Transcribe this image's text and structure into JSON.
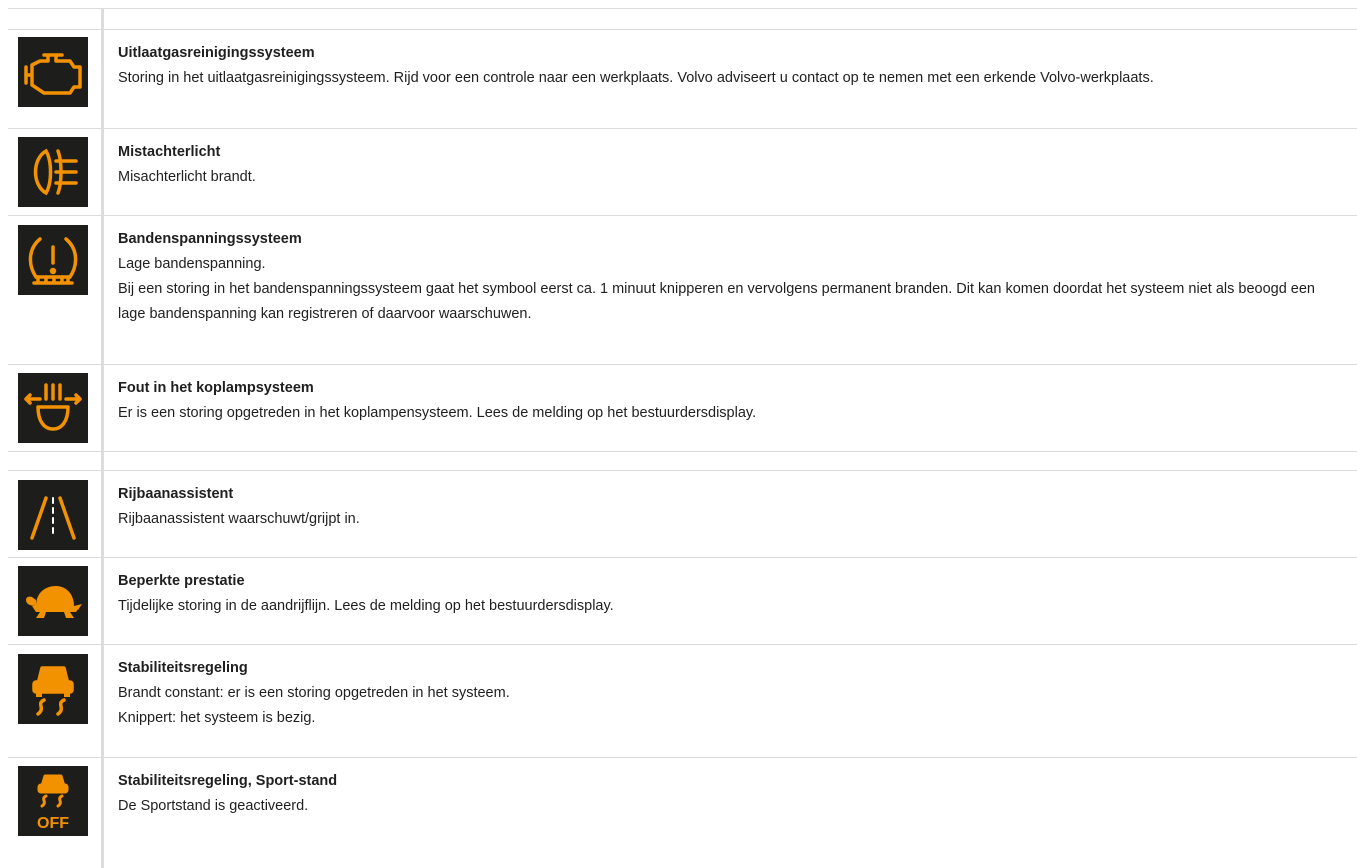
{
  "rows": [
    {
      "icon": "engine-check-icon",
      "title": "Uitlaatgasreinigingssysteem",
      "lines": [
        "Storing in het uitlaatgasreinigingssysteem. Rijd voor een controle naar een werkplaats. Volvo adviseert u contact op te nemen met een erkende Volvo-werkplaats."
      ]
    },
    {
      "icon": "rear-fog-light-icon",
      "title": "Mistachterlicht",
      "lines": [
        "Misachterlicht brandt."
      ]
    },
    {
      "icon": "tire-pressure-icon",
      "title": "Bandenspanningssysteem",
      "lines": [
        "Lage bandenspanning.",
        "Bij een storing in het bandenspanningssysteem gaat het symbool eerst ca. 1 minuut knipperen en vervolgens permanent branden. Dit kan komen doordat het systeem niet als beoogd een lage bandenspanning kan registreren of daarvoor waarschuwen."
      ]
    },
    {
      "icon": "headlamp-fault-icon",
      "title": "Fout in het koplampsysteem",
      "lines": [
        "Er is een storing opgetreden in het koplampensysteem. Lees de melding op het bestuurdersdisplay."
      ]
    },
    {
      "icon": "lane-assist-icon",
      "title": "Rijbaanassistent",
      "lines": [
        "Rijbaanassistent waarschuwt/grijpt in."
      ]
    },
    {
      "icon": "turtle-icon",
      "title": "Beperkte prestatie",
      "lines": [
        "Tijdelijke storing in de aandrijflijn. Lees de melding op het bestuurdersdisplay."
      ]
    },
    {
      "icon": "stability-control-icon",
      "title": "Stabiliteitsregeling",
      "lines": [
        "Brandt constant: er is een storing opgetreden in het systeem.",
        "Knippert: het systeem is bezig."
      ]
    },
    {
      "icon": "stability-control-off-icon",
      "title": "Stabiliteitsregeling, Sport-stand",
      "lines": [
        "De Sportstand is geactiveerd."
      ],
      "icon_text": "OFF"
    }
  ],
  "colors": {
    "icon_bg": "#1d1d1b",
    "icon_fg": "#f39200",
    "border": "#dcdcdc"
  }
}
